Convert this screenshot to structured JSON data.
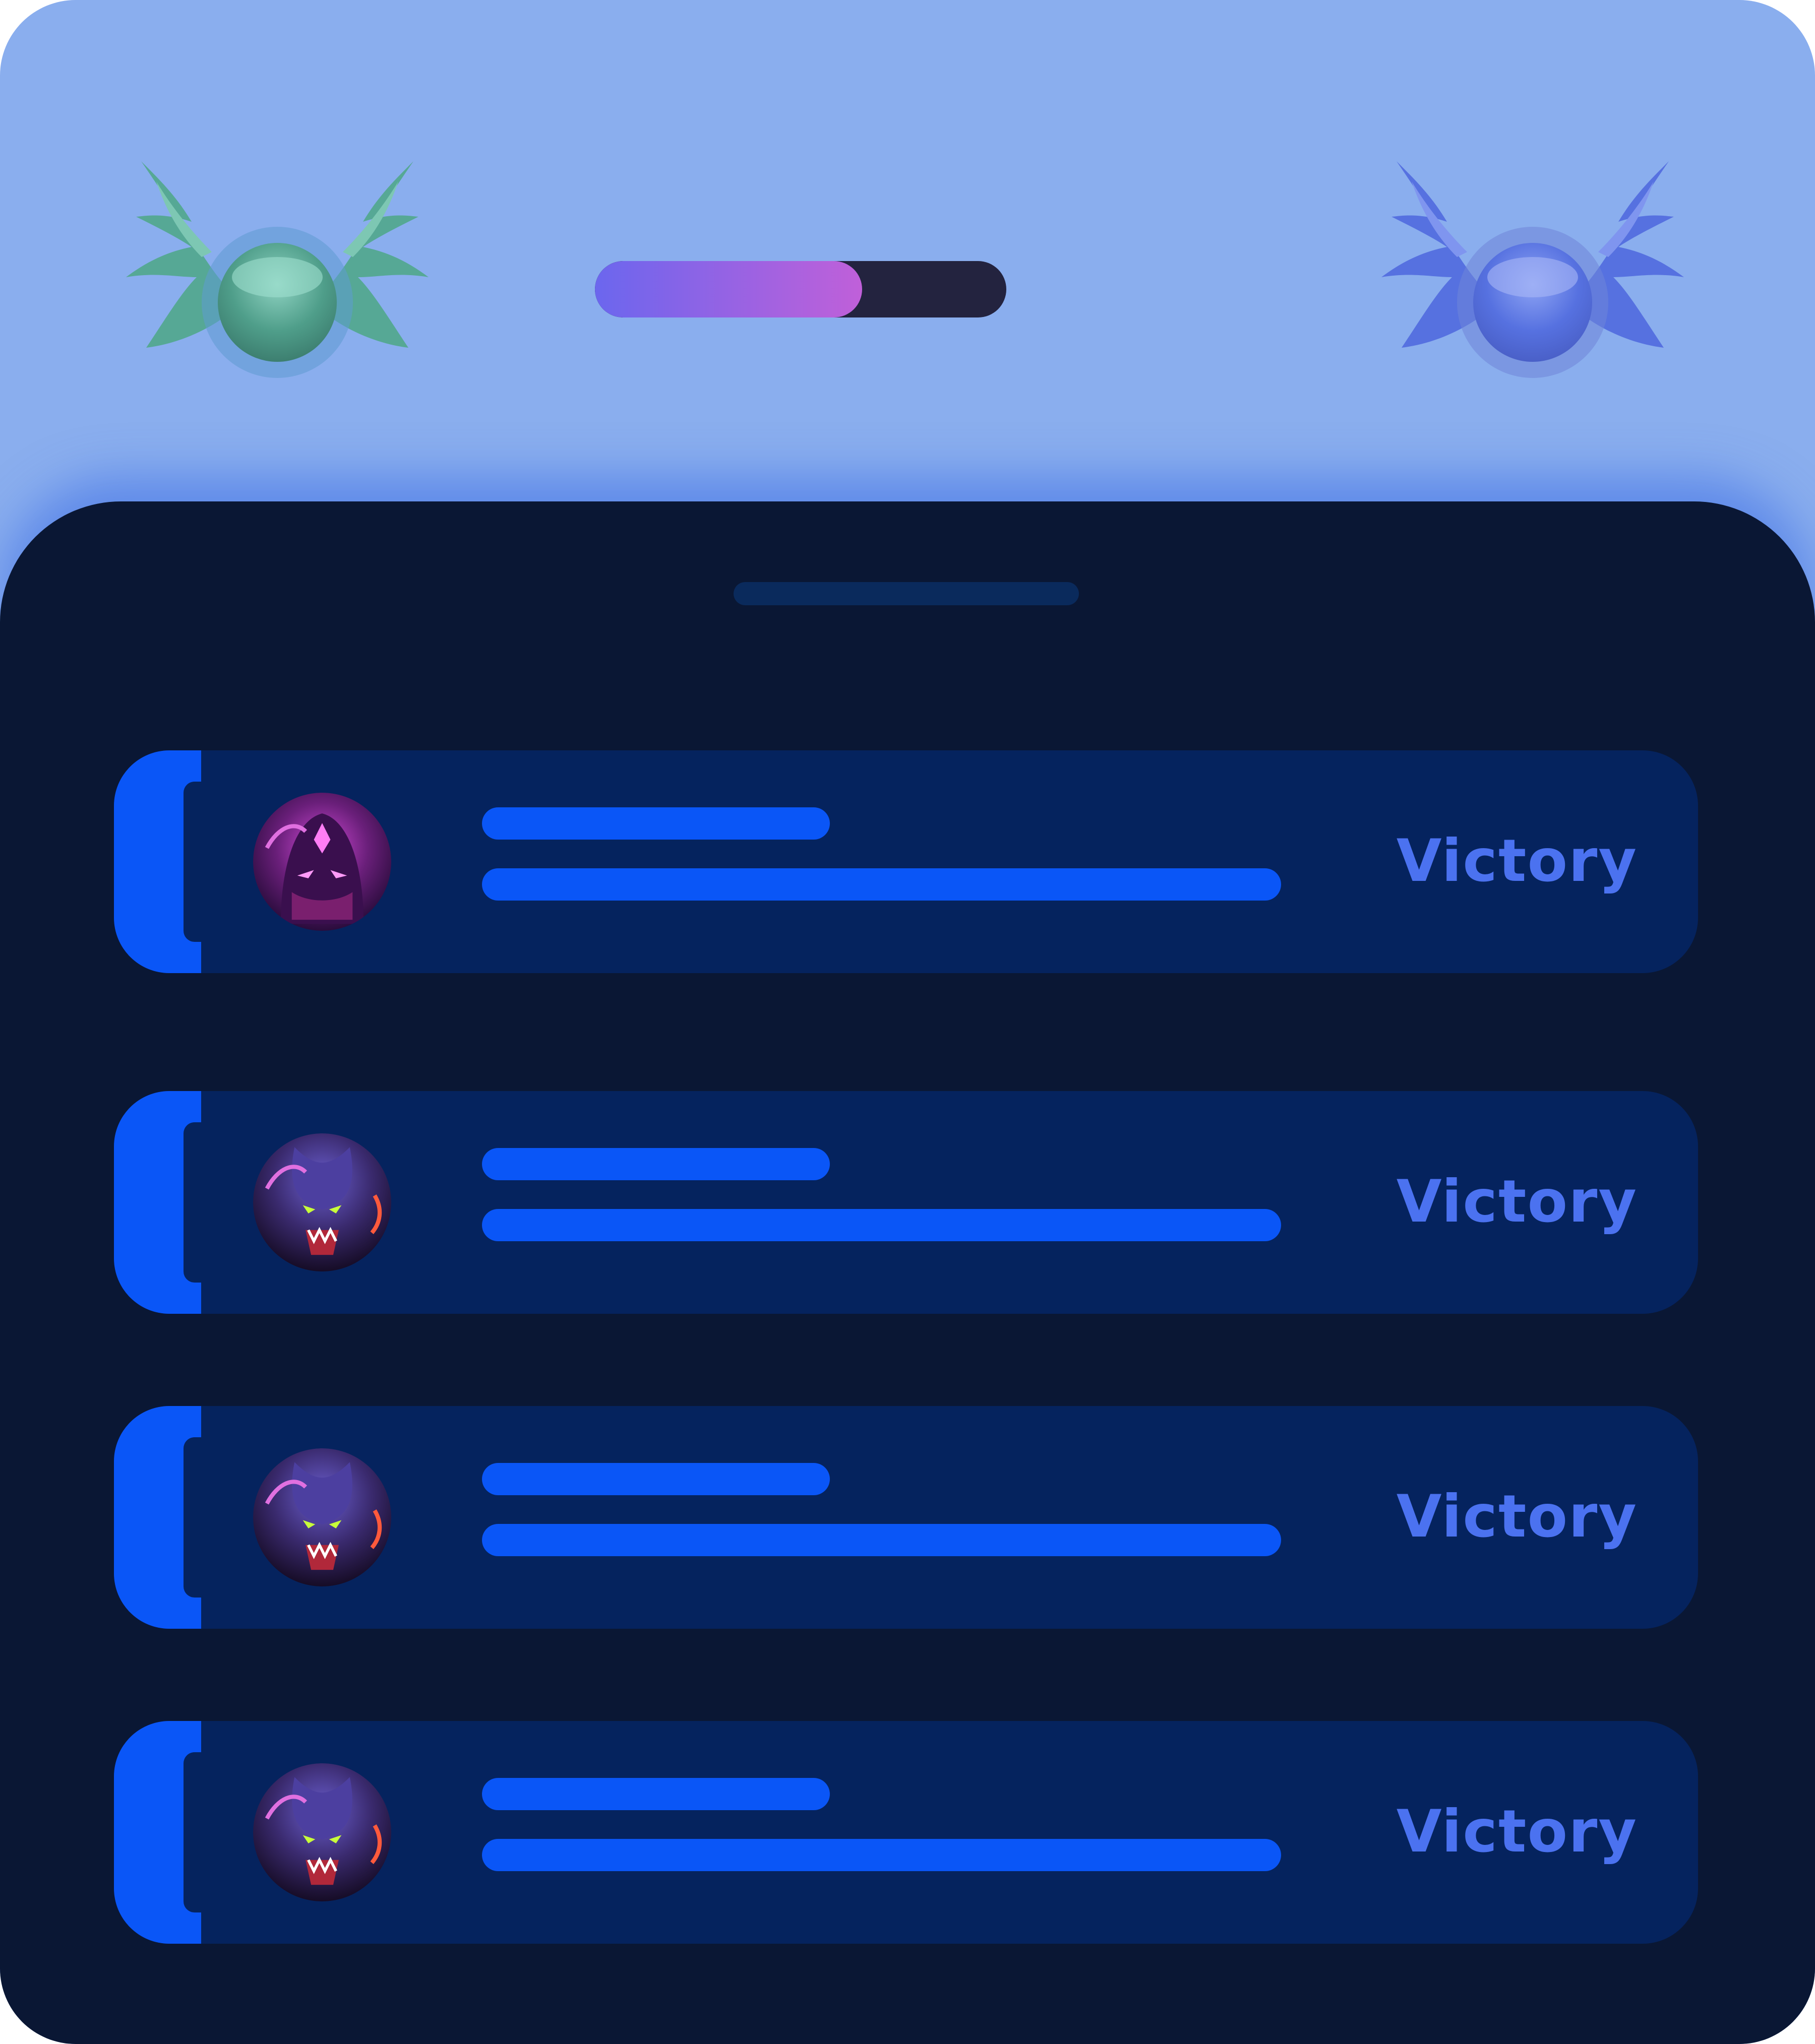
{
  "header": {
    "left_emblem": {
      "icon": "winged-orb-emblem-icon",
      "color": "#56a895"
    },
    "right_emblem": {
      "icon": "winged-orb-emblem-icon",
      "color": "#5671e0"
    },
    "progress": {
      "value": 0.65,
      "fill_start": "#6b66ee",
      "fill_end": "#c060d9",
      "track": "#23233f"
    }
  },
  "sheet": {
    "handle": "drag-handle"
  },
  "matches": [
    {
      "avatar_icon": "hooded-mage-avatar-icon",
      "result": "Victory"
    },
    {
      "avatar_icon": "beast-monster-avatar-icon",
      "result": "Victory"
    },
    {
      "avatar_icon": "beast-monster-avatar-icon",
      "result": "Victory"
    },
    {
      "avatar_icon": "beast-monster-avatar-icon",
      "result": "Victory"
    }
  ],
  "colors": {
    "background_top": "#8aaeee",
    "sheet": "#0a1734",
    "row": "#05235e",
    "accent": "#0a56f7",
    "result_text": "#4b72f0"
  }
}
